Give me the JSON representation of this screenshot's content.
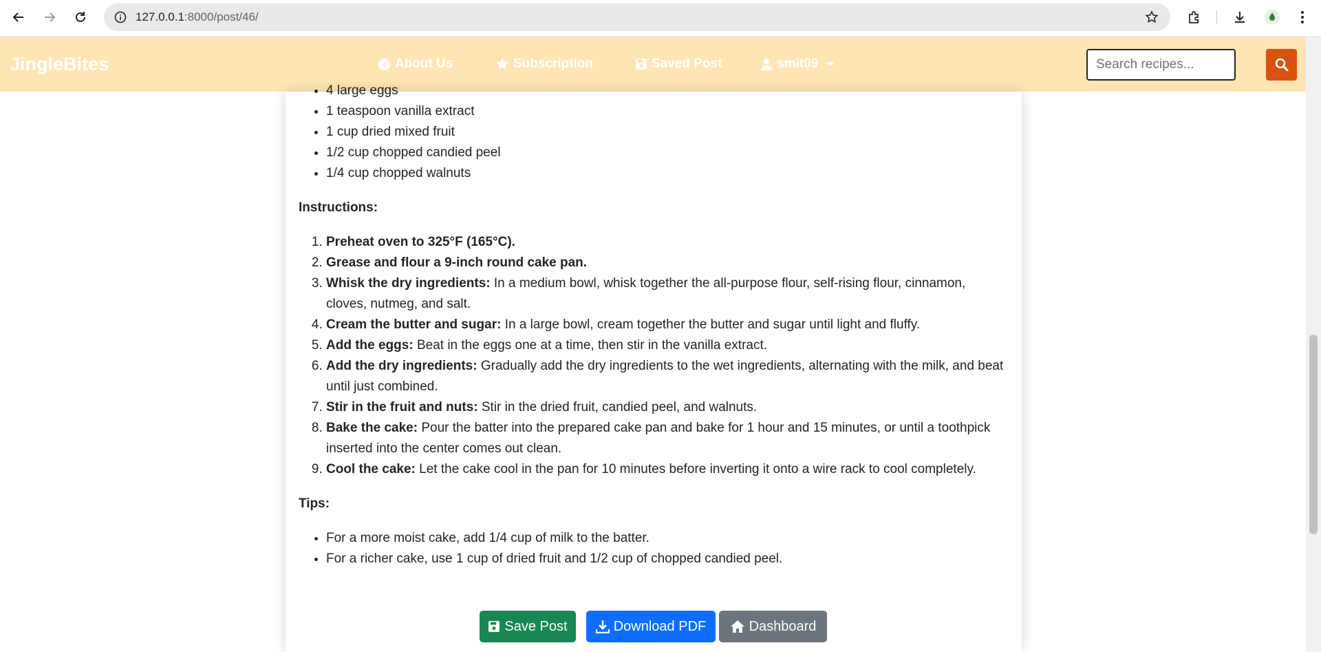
{
  "browser": {
    "url_host": "127.0.0.1",
    "url_path": ":8000/post/46/"
  },
  "navbar": {
    "brand": "JingleBites",
    "links": [
      {
        "label": "About Us",
        "icon": "info-circle-icon"
      },
      {
        "label": "Subscription",
        "icon": "star-icon"
      },
      {
        "label": "Saved Post",
        "icon": "floppy-disk-icon"
      },
      {
        "label": "smit09",
        "icon": "user-icon"
      }
    ],
    "search_placeholder": "Search recipes..."
  },
  "ingredients_tail": [
    "4 large eggs",
    "1 teaspoon vanilla extract",
    "1 cup dried mixed fruit",
    "1/2 cup chopped candied peel",
    "1/4 cup chopped walnuts"
  ],
  "instructions": {
    "heading": "Instructions:",
    "steps": [
      {
        "title": "Preheat oven to 325°F (165°C).",
        "text": ""
      },
      {
        "title": "Grease and flour a 9-inch round cake pan.",
        "text": ""
      },
      {
        "title": "Whisk the dry ingredients:",
        "text": " In a medium bowl, whisk together the all-purpose flour, self-rising flour, cinnamon, cloves, nutmeg, and salt."
      },
      {
        "title": "Cream the butter and sugar:",
        "text": " In a large bowl, cream together the butter and sugar until light and fluffy."
      },
      {
        "title": "Add the eggs:",
        "text": " Beat in the eggs one at a time, then stir in the vanilla extract."
      },
      {
        "title": "Add the dry ingredients:",
        "text": " Gradually add the dry ingredients to the wet ingredients, alternating with the milk, and beat until just combined."
      },
      {
        "title": "Stir in the fruit and nuts:",
        "text": " Stir in the dried fruit, candied peel, and walnuts."
      },
      {
        "title": "Bake the cake:",
        "text": " Pour the batter into the prepared cake pan and bake for 1 hour and 15 minutes, or until a toothpick inserted into the center comes out clean."
      },
      {
        "title": "Cool the cake:",
        "text": " Let the cake cool in the pan for 10 minutes before inverting it onto a wire rack to cool completely."
      }
    ]
  },
  "tips": {
    "heading": "Tips:",
    "items": [
      "For a more moist cake, add 1/4 cup of milk to the batter.",
      "For a richer cake, use 1 cup of dried fruit and 1/2 cup of chopped candied peel."
    ]
  },
  "actions": {
    "save_label": "Save Post",
    "pdf_label": "Download PDF",
    "dashboard_label": "Dashboard"
  },
  "colors": {
    "navbar_bg": "#ffe5b4",
    "search_button": "#d9520f",
    "save_button": "#198754",
    "pdf_button": "#0d6efd",
    "dashboard_button": "#6c757d"
  }
}
